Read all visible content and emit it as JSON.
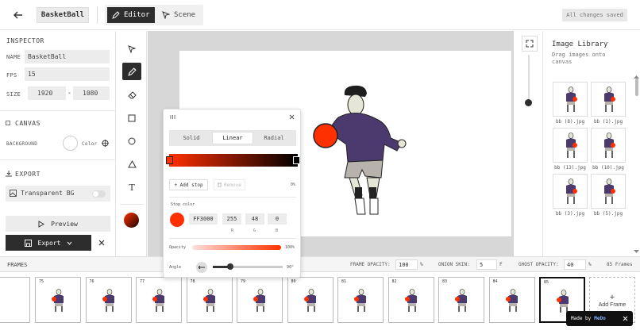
{
  "header": {
    "project_name": "BasketBall",
    "modes": {
      "editor": "Editor",
      "scene": "Scene"
    },
    "save_status": "All changes saved"
  },
  "inspector": {
    "title": "INSPECTOR",
    "name_label": "NAME",
    "name_value": "BasketBall",
    "fps_label": "FPS",
    "fps_value": "15",
    "size_label": "SIZE",
    "width": "1920",
    "height": "1080",
    "canvas_title": "CANVAS",
    "background_label": "BACKGROUND",
    "color_label": "Color",
    "export_title": "EXPORT",
    "transparent_label": "Transparent BG",
    "preview_label": "Preview",
    "export_label": "Export"
  },
  "gradient_popup": {
    "tabs": [
      "Solid",
      "Linear",
      "Radial"
    ],
    "active_tab": "Linear",
    "add_stop": "+ Add stop",
    "remove": "Remove",
    "stop_position": "0%",
    "stop_color_label": "Stop color",
    "hex": "FF3000",
    "r": "255",
    "g": "48",
    "b": "0",
    "r_label": "R",
    "g_label": "G",
    "b_label": "B",
    "opacity_label": "Opacity",
    "opacity_value": "100%",
    "angle_label": "Angle",
    "angle_value": "90°",
    "gradient_start": "#ff3000",
    "gradient_end": "#000000"
  },
  "image_library": {
    "title": "Image Library",
    "subtitle": "Drag images onto canvas",
    "items": [
      "bb (8).jpg",
      "bb (1).jpg",
      "bb (13).jpg",
      "bb (10).jpg",
      "bb (3).jpg",
      "bb (5).jpg"
    ]
  },
  "frames_bar": {
    "title": "FRAMES",
    "frame_opacity_label": "FRAME OPACITY:",
    "frame_opacity": "100",
    "onion_skin_label": "ONION SKIN:",
    "onion_skin": "5",
    "onion_unit": "F",
    "ghost_opacity_label": "GHOST OPACITY:",
    "ghost_opacity": "40",
    "percent": "%",
    "frame_count": "85 Frames"
  },
  "frames": [
    "75",
    "76",
    "77",
    "78",
    "79",
    "80",
    "81",
    "82",
    "83",
    "84",
    "85"
  ],
  "add_frame_label": "Add Frame",
  "made_by": "Made by",
  "brand": "MeDo",
  "colors": {
    "accent": "#ff3000",
    "dark": "#2d2d2d",
    "hoodie": "#4a3a6e"
  },
  "icons": [
    "back-arrow-icon",
    "pencil-icon",
    "cursor-icon",
    "eraser-icon",
    "square-icon",
    "circle-icon",
    "triangle-icon",
    "text-icon",
    "expand-icon",
    "checkbox-icon",
    "eyedropper-icon",
    "download-icon",
    "image-icon",
    "play-icon",
    "save-icon",
    "chevron-down-icon",
    "close-icon",
    "grip-icon",
    "trash-icon"
  ]
}
